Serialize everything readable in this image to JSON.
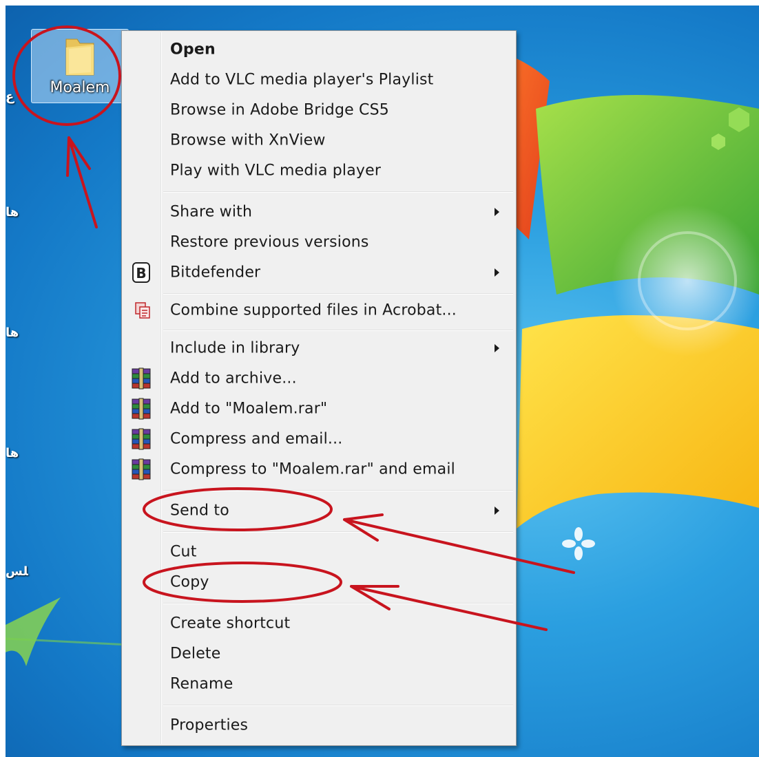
{
  "desktop": {
    "folder": {
      "label": "Moalem",
      "icon": "folder-icon"
    },
    "edge_fragments": [
      "ﻉ",
      "ﻫﺎ",
      "ﻫﺎ",
      "ﻫﺎ",
      "ﻠﺲ"
    ]
  },
  "context_menu": {
    "items": [
      {
        "label": "Open"
      },
      {
        "label": "Add to VLC media player's Playlist"
      },
      {
        "label": "Browse in Adobe Bridge CS5"
      },
      {
        "label": "Browse with XnView"
      },
      {
        "label": "Play with VLC media player"
      },
      {
        "label": "Share with",
        "submenu": true
      },
      {
        "label": "Restore previous versions"
      },
      {
        "label": "Bitdefender",
        "submenu": true,
        "icon": "bitdefender-icon"
      },
      {
        "label": "Combine supported files in Acrobat...",
        "icon": "acrobat-combine-icon"
      },
      {
        "label": "Include in library",
        "submenu": true
      },
      {
        "label": "Add to archive...",
        "icon": "winrar-icon"
      },
      {
        "label": "Add to \"Moalem.rar\"",
        "icon": "winrar-icon"
      },
      {
        "label": "Compress and email...",
        "icon": "winrar-icon"
      },
      {
        "label": "Compress to \"Moalem.rar\" and email",
        "icon": "winrar-icon"
      },
      {
        "label": "Send to",
        "submenu": true
      },
      {
        "label": "Cut"
      },
      {
        "label": "Copy"
      },
      {
        "label": "Create shortcut"
      },
      {
        "label": "Delete"
      },
      {
        "label": "Rename"
      },
      {
        "label": "Properties"
      }
    ]
  },
  "colors": {
    "annotation_red": "#c8141e",
    "menu_background": "#f0f0f0",
    "desktop_blue": "#1e8ad6"
  }
}
